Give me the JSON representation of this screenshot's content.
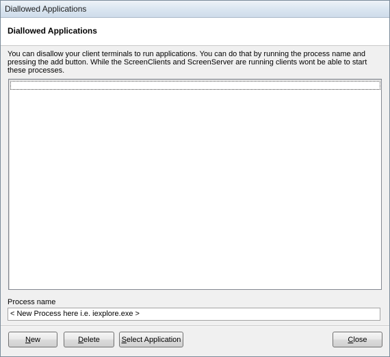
{
  "window": {
    "title": "Diallowed Applications"
  },
  "header": {
    "title": "Diallowed Applications"
  },
  "description": "You can disallow your client terminals to run applications. You can do that by running the process name and pressing the add button. While the ScreenClients and ScreenServer are running clients wont be able to start these processes.",
  "list": {
    "items": []
  },
  "process": {
    "label": "Process name",
    "value": "< New Process here i.e. iexplore.exe >"
  },
  "buttons": {
    "new": {
      "accel": "N",
      "rest": "ew"
    },
    "delete": {
      "accel": "D",
      "rest": "elete"
    },
    "select": {
      "accel": "S",
      "rest": "elect Application"
    },
    "close": {
      "accel": "C",
      "rest": "lose"
    }
  }
}
